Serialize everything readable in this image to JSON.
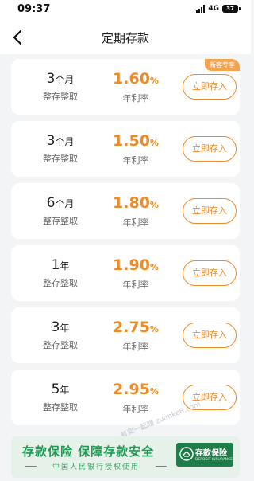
{
  "status_bar": {
    "time": "09:37",
    "network": "4G",
    "battery": "37"
  },
  "nav": {
    "title": "定期存款",
    "back_icon": "chevron-left-icon"
  },
  "colors": {
    "accent": "#f08a24",
    "tag": "#f5a34f",
    "banner_green": "#1f9b55"
  },
  "products": [
    {
      "term_value": "3",
      "term_unit": "个月",
      "term_type": "整存整取",
      "rate_value": "1.60",
      "rate_unit": "%",
      "rate_label": "年利率",
      "button": "立即存入",
      "tag": "新客专享"
    },
    {
      "term_value": "3",
      "term_unit": "个月",
      "term_type": "整存整取",
      "rate_value": "1.50",
      "rate_unit": "%",
      "rate_label": "年利率",
      "button": "立即存入"
    },
    {
      "term_value": "6",
      "term_unit": "个月",
      "term_type": "整存整取",
      "rate_value": "1.80",
      "rate_unit": "%",
      "rate_label": "年利率",
      "button": "立即存入"
    },
    {
      "term_value": "1",
      "term_unit": "年",
      "term_type": "整存整取",
      "rate_value": "1.90",
      "rate_unit": "%",
      "rate_label": "年利率",
      "button": "立即存入"
    },
    {
      "term_value": "3",
      "term_unit": "年",
      "term_type": "整存整取",
      "rate_value": "2.75",
      "rate_unit": "%",
      "rate_label": "年利率",
      "button": "立即存入"
    },
    {
      "term_value": "5",
      "term_unit": "年",
      "term_type": "整存整取",
      "rate_value": "2.95",
      "rate_unit": "%",
      "rate_label": "年利率",
      "button": "立即存入"
    }
  ],
  "banner": {
    "title": "存款保险 保障存款安全",
    "subtitle": "中国人民银行授权使用",
    "badge_cn": "存款保险",
    "badge_en": "DEPOSIT INSURANCE"
  },
  "watermark": "有奖一起赚 zuanke8.com"
}
